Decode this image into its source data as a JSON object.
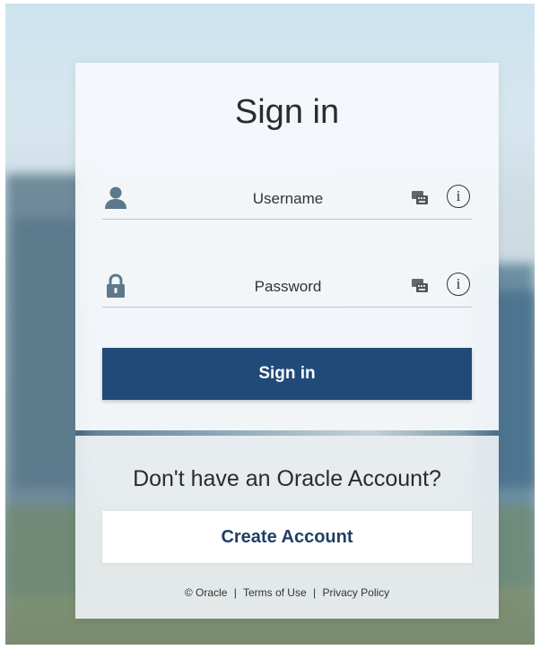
{
  "page": {
    "title": "Sign in",
    "username": {
      "placeholder": "Username",
      "value": ""
    },
    "password": {
      "placeholder": "Password",
      "value": ""
    },
    "signin_button": "Sign in",
    "no_account_text": "Don't have an Oracle Account?",
    "create_button": "Create Account",
    "footer": {
      "copyright": "© Oracle",
      "separator": "|",
      "terms": "Terms of Use",
      "privacy": "Privacy Policy"
    },
    "info_glyph": "i"
  },
  "icons": {
    "username_lead": "user-icon",
    "password_lead": "lock-icon",
    "keyboard": "keyboard-icon",
    "info": "info-icon"
  },
  "colors": {
    "primary_button": "#204a78",
    "create_button_text": "#1f3f66",
    "icon_gray_blue": "#5d7889"
  }
}
